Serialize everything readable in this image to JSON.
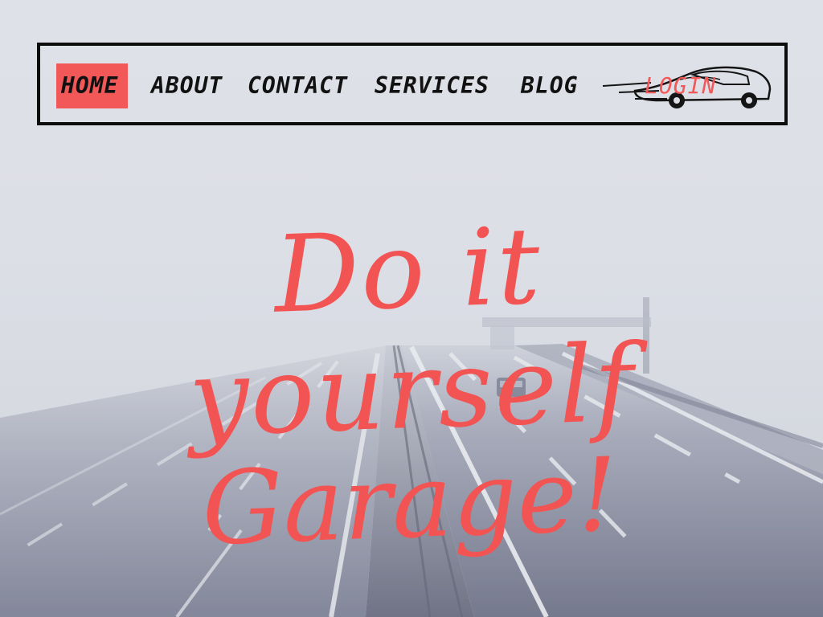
{
  "colors": {
    "accent": "#f25858",
    "text_dark": "#111111",
    "fog": "#dcdee6",
    "road": "#6d7186"
  },
  "nav": {
    "items": [
      {
        "label": "HOME",
        "active": true
      },
      {
        "label": "ABOUT",
        "active": false
      },
      {
        "label": "CONTACT",
        "active": false
      },
      {
        "label": "SERVICES",
        "active": false
      },
      {
        "label": "BLOG",
        "active": false
      }
    ],
    "login_label": "LOGIN",
    "logo_icon": "car-icon"
  },
  "hero": {
    "line1": "Do it yourself",
    "line2": "Garage!"
  }
}
